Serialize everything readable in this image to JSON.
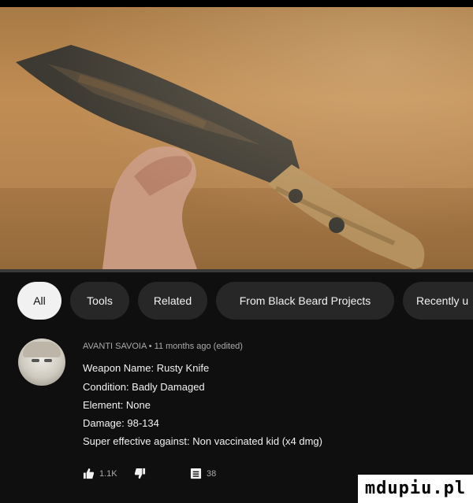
{
  "video": {
    "progress_percent": 0
  },
  "chips": [
    {
      "label": "All",
      "active": true
    },
    {
      "label": "Tools",
      "active": false
    },
    {
      "label": "Related",
      "active": false
    },
    {
      "label": "From Black Beard Projects",
      "active": false
    },
    {
      "label": "Recently u",
      "active": false
    }
  ],
  "comment": {
    "meta": "AVANTI SAVOIA • 11 months ago (edited)",
    "lines": [
      "Weapon Name: Rusty Knife",
      "Condition: Badly Damaged",
      "Element: None",
      "Damage: 98-134",
      "Super effective against: Non vaccinated kid (x4 dmg)"
    ],
    "likes": "1.1K",
    "replies": "38"
  },
  "watermark": "mdupiu.pl"
}
